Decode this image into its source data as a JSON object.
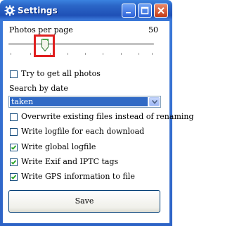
{
  "window": {
    "title": "Settings",
    "icons": [
      "gear-icon",
      "minimize-icon",
      "maximize-icon",
      "close-icon"
    ]
  },
  "photos_per_page": {
    "label": "Photos per page",
    "value": "50",
    "slider_position": 0.2,
    "highlight_color": "#e02020"
  },
  "options": {
    "try_all": {
      "label": "Try to get all photos",
      "checked": false
    },
    "search_by_date_label": "Search by date",
    "search_by_date_value": "taken",
    "overwrite": {
      "label": "Overwrite existing files instead of renaming",
      "checked": false
    },
    "logfile_each": {
      "label": "Write logfile for each download",
      "checked": false
    },
    "global_logfile": {
      "label": "Write global logfile",
      "checked": true
    },
    "exif_iptc": {
      "label": "Write Exif and IPTC tags",
      "checked": true
    },
    "gps": {
      "label": "Write GPS information to file",
      "checked": true
    }
  },
  "save_label": "Save",
  "colors": {
    "titlebar": "#2b66c7",
    "selection": "#316ac5",
    "checkbox_border": "#1c5180"
  }
}
